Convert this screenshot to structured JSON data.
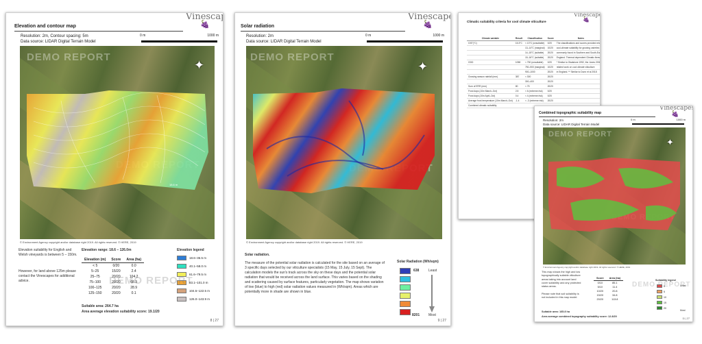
{
  "brand": "Vinescapes",
  "grape": "🍇",
  "demo_watermark": "DEMO REPORT",
  "north_icon": "compass-rose-icon",
  "colors": {
    "elev_legend": [
      "#2e7dd6",
      "#2fe0c0",
      "#f2ef5a",
      "#f0a535",
      "#d5a27c",
      "#c8c0c0"
    ],
    "solar_legend": [
      "#2e3fb8",
      "#2fbfe0",
      "#6ef0a0",
      "#e6f06a",
      "#f08a35",
      "#d82020"
    ],
    "topo_legend": [
      "#e24b4b",
      "#f0a060",
      "#c8e070",
      "#60c040",
      "#2e8b2e"
    ]
  },
  "page1": {
    "title": "Elevation and contour map",
    "resolution": "Resolution: 2m,   Contour spacing: 5m",
    "source": "Data source: LIDAR Digital Terrain Model",
    "scale_start": "0 m",
    "scale_end": "1000 m",
    "elev_marker": "18.6 m",
    "copyright": "© Environment Agency copyright and/or database right 2019. All rights reserved. © HERE, 2019",
    "note1": "Elevation suitability for English and Welsh vineyards is between 5 – 150m.",
    "note2": "However, for land above 125m please contact the Vinescapes for additional advice.",
    "range_label": "Elevation range: 18.6 – 126.0m",
    "table_headers": [
      "Elevation (m)",
      "Score",
      "Area (ha)"
    ],
    "table_rows": [
      [
        "< 5",
        "0/20",
        "0.0"
      ],
      [
        "5–25",
        "15/20",
        "2.4"
      ],
      [
        "25–75",
        "20/20",
        "104.2"
      ],
      [
        "75–100",
        "20/20",
        "68.3"
      ],
      [
        "100–125",
        "20/20",
        "28.9"
      ],
      [
        "125–150",
        "20/20",
        "0.1"
      ]
    ],
    "legend_title": "Elevation legend",
    "legend": [
      "18.6–36.5 m",
      "40.1–58.0 m",
      "61.6–79.5 m",
      "83.1–101.0 m",
      "104.5–122.5 m",
      "126.0–143.9 m"
    ],
    "suitable_area": "Suitable area: 264.7 ha",
    "avg_score": "Area average elevation suitability score: 19.1/20",
    "page_no": "8 | 27"
  },
  "page2": {
    "title": "Solar radiation",
    "resolution": "Resolution: 2m",
    "source": "Data source: LIDAR Digital Terrain Model",
    "scale_start": "0 m",
    "scale_end": "1000 m",
    "copyright": "© Environment Agency copyright and/or database right 2019. All rights reserved. © HERE, 2019",
    "heading": "Solar radiation.",
    "body": "The measure of the potential solar radiation is calculated for the site based on an average of 3 specific days selected by our viticulture specialists (15 May, 15 July, 15 Sept). The calculation models the sun's track across the sky on these days and the potential solar radiation that would be received across the land surface. This varies based on the shading and scattering caused by surface features, particularly vegetation. The map shows variation of low (blue) to high (red) solar radiation values measured in (Wh/sqm). Areas which are potentially more in shade are shown in blue.",
    "legend_title": "Solar Radiation (Wh/sqm)",
    "legend_low": "638",
    "legend_low_label": "Least",
    "legend_high": "8201",
    "legend_high_label": "Most",
    "page_no": "9 | 27"
  },
  "page3": {
    "title": "Climatic suitability criteria for cool climate viticulture",
    "headers": [
      "Climate variable",
      "Result",
      "Classification",
      "Score",
      "Notes"
    ],
    "rows": [
      [
        "GST(°C)",
        "15.3°C",
        "< 13°C (unsuitable)",
        "0/20",
        "The classifications and scores provided relate to"
      ],
      [
        "",
        "",
        "13–14°C (marginal)",
        "10/20",
        "cool-climate suitability for growing varieties"
      ],
      [
        "",
        "",
        "14–15°C (suitable)",
        "20/20",
        "commonly found in Southern and South-Eastern"
      ],
      [
        "",
        "",
        "15–16°C (suitable)",
        "20/20",
        "England. Thermal dependent Climatic thresholds"
      ],
      [
        "GDD",
        "1058",
        "< 750 (unsuitable)",
        "0/20",
        "* Similar to Gladstone 1992, the Jones 2006 and"
      ],
      [
        "",
        "",
        "750–900 (marginal)",
        "10/20",
        "related work on cool climate viticulture"
      ],
      [
        "",
        "",
        "900–1000",
        "20/20",
        "in England. ** Similar to Dunn et al 2018"
      ],
      [
        "Growing season rainfall (mm)",
        "387",
        "< 300",
        "20/20",
        ""
      ],
      [
        "",
        "",
        "300–400",
        "20/20",
        ""
      ],
      [
        "Sum of ERR (mm)",
        "80",
        "< 75",
        "20/20",
        ""
      ],
      [
        "Frost days (10m March–Oct)",
        "2.5",
        "< 6 (extreme risk)",
        "0/20",
        ""
      ],
      [
        "Frost days (10m April–Oct)",
        "0.4",
        "< 4 (extreme risk)",
        "0/20",
        ""
      ],
      [
        "Average frost temperature (10m March–Oct)",
        "-1.4",
        "< -3 (extreme risk)",
        "20/20",
        ""
      ],
      [
        "Combined climatic suitability",
        "",
        "",
        "",
        ""
      ]
    ]
  },
  "page4": {
    "title": "Combined topographic suitability map",
    "resolution": "Resolution: 2m",
    "source": "Data source: LIDAR Digital Terrain Model",
    "scale_start": "0 m",
    "scale_end": "1000 m",
    "copyright": "© Environment Agency copyright and/or database right 2019. All rights reserved. © HERE, 2019",
    "body1": "This map shows the high and low topographically suitable viticulture areas taking into account land cover suitability and any protected status areas.",
    "body2": "Please note that soil suitability is not included in this map model.",
    "table_headers": [
      "Score",
      "Area (ha)"
    ],
    "table_rows": [
      [
        "0/10",
        "85.1"
      ],
      [
        "5/10",
        "11.4"
      ],
      [
        "10/20",
        "20.8"
      ],
      [
        "15/20",
        "34.8"
      ],
      [
        "20/20",
        "113.8"
      ]
    ],
    "legend_title": "Suitability legend",
    "legend_top": "Least",
    "legend_bottom": "Most",
    "legend": [
      "0",
      "5",
      "10",
      "15",
      "20"
    ],
    "suitable_area": "Suitable area: 165.8 ha",
    "avg_score": "Area average combined topography suitability score: 12.8/20",
    "page_no": "11 | 27"
  }
}
